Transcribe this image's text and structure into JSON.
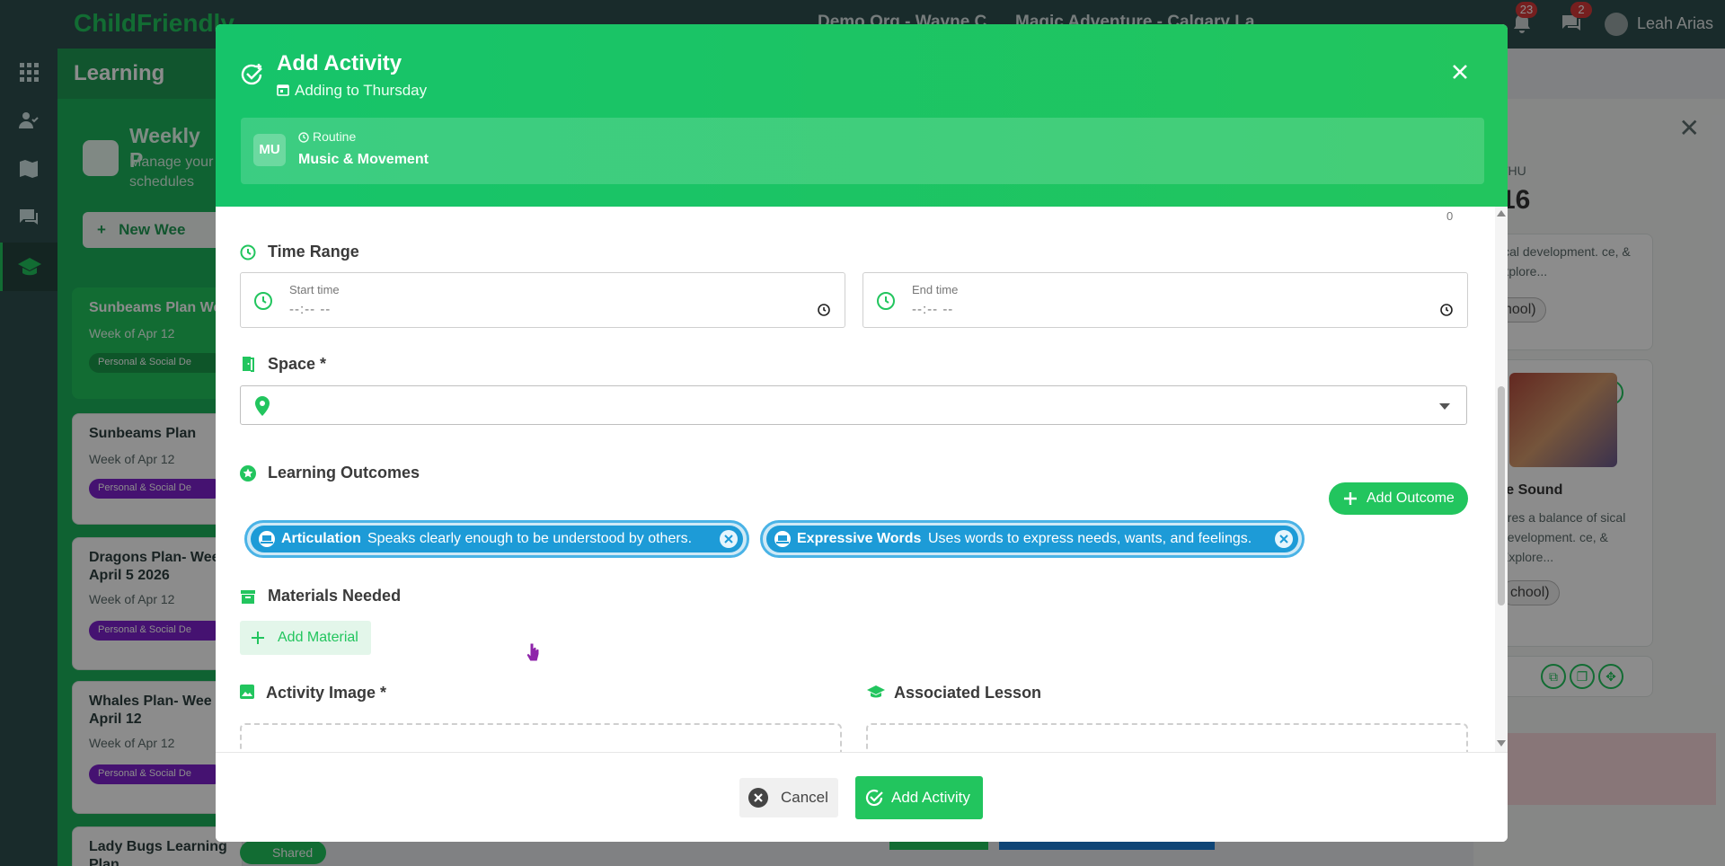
{
  "app": {
    "logo": "ChildFriendly",
    "org": "Demo Org - Wayne C",
    "site": "Magic Adventure - Calgary La",
    "notifications_count": "23",
    "messages_count": "2",
    "user_name": "Leah Arias"
  },
  "sidebar": {
    "section_title": "Learning",
    "panel_title": "Weekly P",
    "panel_subtitle": "Manage your schedules",
    "new_week_button": "New Wee",
    "plans": [
      {
        "title": "Sunbeams Plan We",
        "week": "Week of Apr 12",
        "tag": "Personal & Social De"
      },
      {
        "title": "Sunbeams Plan",
        "week": "Week of Apr 12",
        "tag": "Personal & Social De"
      },
      {
        "title": "Dragons Plan- Wee of April 5 2026",
        "week": "Week of Apr 12",
        "tag": "Personal & Social De"
      },
      {
        "title": "Whales Plan- Wee of April 12",
        "week": "Week of Apr 12",
        "tag": "Personal & Social De"
      },
      {
        "title": "Lady Bugs Learning Plan",
        "week": "",
        "tag": ""
      }
    ],
    "shared_badge": "Shared"
  },
  "right_panel": {
    "day_label": "THU",
    "day_number": "16",
    "card1_text": "sical development. ce, & Explore...",
    "card1_chip": "chool)",
    "card2_title": "re Sound",
    "card2_text": "ures a balance of sical development. ce, & Explore...",
    "card2_chip": "chool)"
  },
  "modal": {
    "title": "Add Activity",
    "subtitle": "Adding to Thursday",
    "routine": {
      "avatar": "MU",
      "label": "Routine",
      "name": "Music & Movement"
    },
    "scroll_indicator": "0",
    "time_range": {
      "label": "Time Range",
      "start_label": "Start time",
      "start_value": "--:-- --",
      "end_label": "End time",
      "end_value": "--:-- --"
    },
    "space": {
      "label": "Space *",
      "value": ""
    },
    "learning_outcomes": {
      "label": "Learning Outcomes",
      "add_button": "Add Outcome",
      "items": [
        {
          "title": "Articulation",
          "description": "Speaks clearly enough to be understood by others."
        },
        {
          "title": "Expressive Words",
          "description": "Uses words to express needs, wants, and feelings."
        }
      ]
    },
    "materials": {
      "label": "Materials Needed",
      "add_button": "Add Material"
    },
    "activity_image": {
      "label": "Activity Image *"
    },
    "associated_lesson": {
      "label": "Associated Lesson"
    },
    "footer": {
      "cancel": "Cancel",
      "submit": "Add Activity"
    }
  },
  "colors": {
    "primary": "#22c55e",
    "chip_blue": "#1d9bd7",
    "nav_dark": "#2f4f4f"
  }
}
